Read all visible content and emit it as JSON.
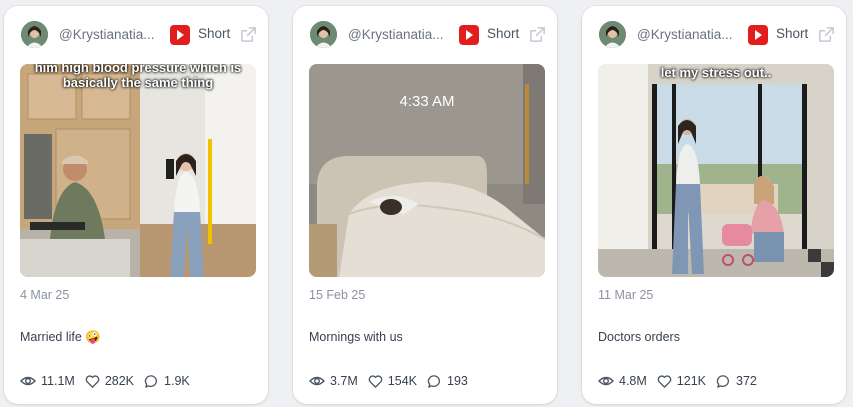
{
  "cards": [
    {
      "handle": "@Krystianatia...",
      "platform_label": "Short",
      "platform_icon": "youtube-icon",
      "overlay_text": "him high blood pressure which is basically the same thing",
      "date": "4 Mar 25",
      "title": "Married life 🤪",
      "views": "11.1M",
      "likes": "282K",
      "comments": "1.9K"
    },
    {
      "handle": "@Krystianatia...",
      "platform_label": "Short",
      "platform_icon": "youtube-icon",
      "overlay_text": "4:33 AM",
      "date": "15 Feb 25",
      "title": "Mornings with us",
      "views": "3.7M",
      "likes": "154K",
      "comments": "193"
    },
    {
      "handle": "@Krystianatia...",
      "platform_label": "Short",
      "platform_icon": "youtube-icon",
      "overlay_text": "let my stress out..",
      "date": "11 Mar 25",
      "title": "Doctors orders",
      "views": "4.8M",
      "likes": "121K",
      "comments": "372"
    }
  ],
  "icons": {
    "views": "eye-icon",
    "likes": "heart-icon",
    "comments": "comment-icon",
    "external": "external-link-icon"
  }
}
